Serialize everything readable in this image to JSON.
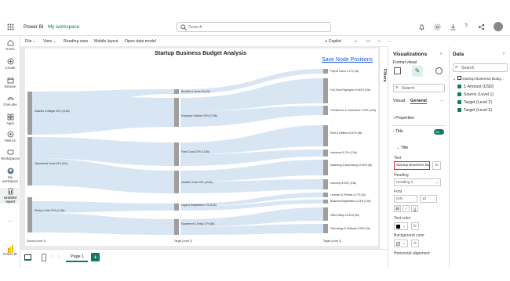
{
  "app": {
    "brand": "Power BI",
    "workspace": "My workspace",
    "search_placeholder": "Search"
  },
  "rail": [
    {
      "label": "Home"
    },
    {
      "label": "Create"
    },
    {
      "label": "Browse"
    },
    {
      "label": "OneLake"
    },
    {
      "label": "Apps"
    },
    {
      "label": "Metrics"
    },
    {
      "label": "Workspaces"
    },
    {
      "label": "My workspace"
    },
    {
      "label": "Untitled report"
    },
    {
      "label": "..."
    }
  ],
  "rail_bottom": "Power BI",
  "menu": {
    "file": "File",
    "view": "View",
    "reading": "Reading view",
    "mobile": "Mobile layout",
    "model": "Open data model",
    "copilot": "Copilot"
  },
  "report": {
    "title": "Startup Business Budget Analysis",
    "link": "Save Node Positions",
    "stage1": [
      "Salaries & Wages 32% (15.8k)",
      "Operational Costs 44% (21k)",
      "Startup Costs 24% (11.8k)"
    ],
    "stage2": [
      "Benefits & Taxes 4% (2k)",
      "Employee Salaries 28% (13.8k)",
      "Fixed Costs 22% (10.8k)",
      "Variable Costs 22% (10.8k)",
      "Legal & Registration 7% (3.3k)",
      "Equipment & Setup 17% (8k)"
    ],
    "stage3": [
      "Payroll Taxes 4.17% (2k)",
      "Full-Time Employees 20.83% (10k)",
      "Freelancers & Contractors 7.29% (3.5k)",
      "Rent & Utilities 16.67% (8k)",
      "Insurance 5.21% (2.5k)",
      "Marketing & Advertising 12.50% (6k)",
      "Inventory 8.33% (4.5k)",
      "Licenses & Permits 4.17% (2k)",
      "Business Registration 3.13% (1.5k)",
      "Office Setup 10.42% (5k)",
      "Technology & Software 6.25% (3k)"
    ],
    "axis": [
      "Source (Level 1)",
      "Target (Level 2)",
      "Target (Level 3)"
    ]
  },
  "pages": {
    "page1": "Page 1",
    "add": "+"
  },
  "filters_label": "Filters",
  "viz": {
    "title": "Visualizations",
    "format": "Format visual",
    "search": "Search",
    "tab_visual": "Visual",
    "tab_general": "General",
    "properties": "Properties",
    "title_section": "Title",
    "toggle": "On",
    "title_sub": "Title",
    "text_label": "Text",
    "text_value": "Startup Business Bu",
    "heading_label": "Heading",
    "heading_value": "Heading 3",
    "font_label": "Font",
    "font_value": "DIN",
    "font_size": "10",
    "bold": "B",
    "italic": "I",
    "underline": "U",
    "text_color": "Text color",
    "bg_color": "Background color",
    "h_align": "Horizontal alignment",
    "fx": "fx"
  },
  "data": {
    "title": "Data",
    "search": "Search",
    "table": "Startup Business Budg...",
    "fields": [
      "Amount (USD)",
      "Source (Level 1)",
      "Target (Level 2)",
      "Target (Level 3)"
    ]
  }
}
